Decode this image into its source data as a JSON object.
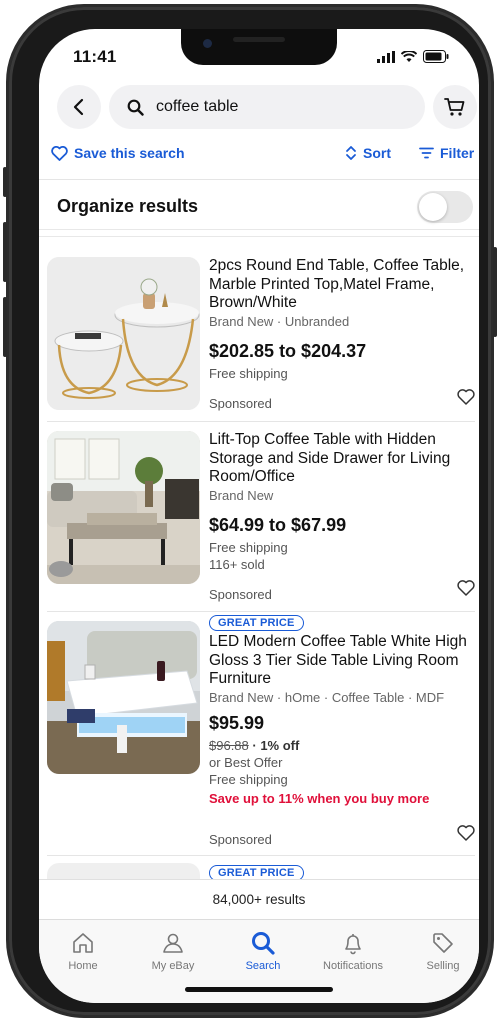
{
  "status_bar": {
    "time": "11:41"
  },
  "search": {
    "query": "coffee table"
  },
  "actions": {
    "save_search": "Save this search",
    "sort": "Sort",
    "filter": "Filter"
  },
  "organize": {
    "label": "Organize results",
    "toggle_on": false
  },
  "items": [
    {
      "title": "2pcs Round End Table, Coffee Table, Marble Printed Top,Matel Frame, Brown/White",
      "meta": "Brand New · Unbranded",
      "price": "$202.85 to $204.37",
      "shipping": "Free shipping",
      "sponsored": "Sponsored"
    },
    {
      "title": "Lift-Top Coffee Table with Hidden Storage and Side Drawer for Living Room/Office",
      "meta": "Brand New",
      "price": "$64.99 to $67.99",
      "shipping": "Free shipping",
      "sold": "116+ sold",
      "sponsored": "Sponsored"
    },
    {
      "badge": "GREAT PRICE",
      "title": "LED Modern Coffee Table White High Gloss 3 Tier Side Table Living Room Furniture",
      "meta": "Brand New · hOme · Coffee Table · MDF",
      "price": "$95.99",
      "original_price": "$96.88",
      "discount": " · 1% off",
      "best_offer": "or Best Offer",
      "shipping": "Free shipping",
      "promo": "Save up to 11% when you buy more",
      "sponsored": "Sponsored"
    },
    {
      "badge": "GREAT PRICE"
    }
  ],
  "results_count": "84,000+ results",
  "tabs": [
    {
      "label": "Home",
      "icon": "home-icon"
    },
    {
      "label": "My eBay",
      "icon": "person-icon"
    },
    {
      "label": "Search",
      "icon": "search-icon",
      "active": true
    },
    {
      "label": "Notifications",
      "icon": "bell-icon"
    },
    {
      "label": "Selling",
      "icon": "tag-icon"
    }
  ],
  "colors": {
    "accent": "#1a5bd6",
    "promo": "#e0103a"
  }
}
